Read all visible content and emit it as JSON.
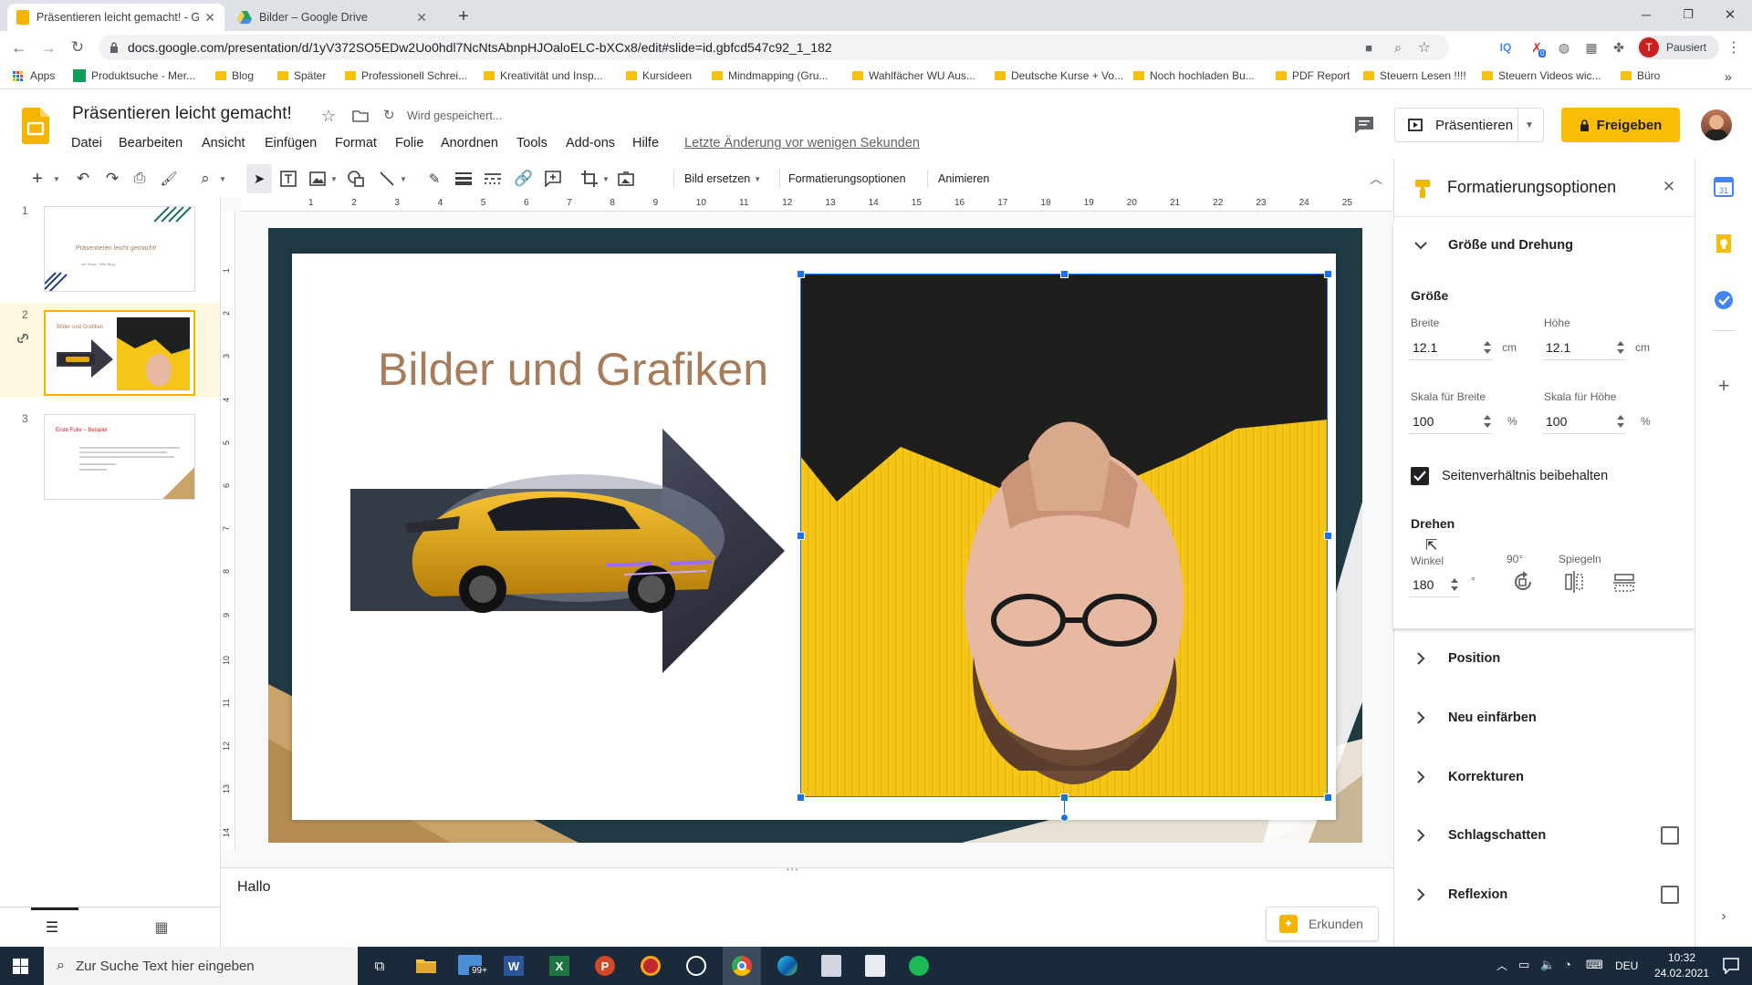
{
  "tabs": [
    {
      "title": "Präsentieren leicht gemacht! - G",
      "active": true
    },
    {
      "title": "Bilder – Google Drive",
      "active": false
    }
  ],
  "browser": {
    "url": "docs.google.com/presentation/d/1yV372SO5EDw2Uo0hdl7NcNtsAbnpHJOaloELC-bXCx8/edit#slide=id.gbfcd547c92_1_182",
    "profile_label": "Pausiert",
    "profile_initial": "T",
    "extension_badge": "0"
  },
  "bookmarks": [
    {
      "label": "Apps"
    },
    {
      "label": "Produktsuche - Mer..."
    },
    {
      "label": "Blog"
    },
    {
      "label": "Später"
    },
    {
      "label": "Professionell Schrei..."
    },
    {
      "label": "Kreativität und Insp..."
    },
    {
      "label": "Kursideen"
    },
    {
      "label": "Mindmapping (Gru..."
    },
    {
      "label": "Wahlfächer WU Aus..."
    },
    {
      "label": "Deutsche Kurse + Vo..."
    },
    {
      "label": "Noch hochladen Bu..."
    },
    {
      "label": "PDF Report"
    },
    {
      "label": "Steuern Lesen !!!!"
    },
    {
      "label": "Steuern Videos wic..."
    },
    {
      "label": "Büro"
    }
  ],
  "doc": {
    "title": "Präsentieren leicht gemacht!",
    "save_status": "Wird gespeichert...",
    "last_edit": "Letzte Änderung vor wenigen Sekunden",
    "present_label": "Präsentieren",
    "share_label": "Freigeben"
  },
  "menus": [
    "Datei",
    "Bearbeiten",
    "Ansicht",
    "Einfügen",
    "Format",
    "Folie",
    "Anordnen",
    "Tools",
    "Add-ons",
    "Hilfe"
  ],
  "toolbar": {
    "replace_image": "Bild ersetzen",
    "format_options": "Formatierungsoptionen",
    "animate": "Animieren"
  },
  "ruler": {
    "top": [
      "1",
      "2",
      "3",
      "4",
      "5",
      "6",
      "7",
      "8",
      "9",
      "10",
      "11",
      "12",
      "13",
      "14",
      "15",
      "16",
      "17",
      "18",
      "19",
      "20",
      "21",
      "22",
      "23",
      "24",
      "25"
    ],
    "left": [
      "1",
      "2",
      "3",
      "4",
      "5",
      "6",
      "7",
      "8",
      "9",
      "10",
      "11",
      "12",
      "13",
      "14"
    ]
  },
  "slides": [
    {
      "number": "1",
      "title": "Präsentieren leicht gemacht!",
      "subtitle": "mit Tanja - Hilfe Blog"
    },
    {
      "number": "2",
      "title": "Bilder und Grafiken"
    },
    {
      "number": "3",
      "title": "Erste Folie – Beispiel"
    }
  ],
  "slide": {
    "title": "Bilder und Grafiken"
  },
  "notes": {
    "text": "Hallo",
    "explore_label": "Erkunden"
  },
  "panel": {
    "title": "Formatierungsoptionen",
    "size_section": "Größe und Drehung",
    "size_heading": "Größe",
    "width_label": "Breite",
    "width_value": "12.1",
    "height_label": "Höhe",
    "height_value": "12.1",
    "unit_cm": "cm",
    "scale_w_label": "Skala für Breite",
    "scale_w_value": "100",
    "scale_h_label": "Skala für Höhe",
    "scale_h_value": "100",
    "unit_pct": "%",
    "aspect_label": "Seitenverhältnis beibehalten",
    "aspect_checked": true,
    "rotate_heading": "Drehen",
    "angle_label": "Winkel",
    "angle_value": "180",
    "degree": "°",
    "rotate90_label": "90°",
    "mirror_label": "Spiegeln",
    "sections": [
      "Position",
      "Neu einfärben",
      "Korrekturen",
      "Schlagschatten",
      "Reflexion"
    ]
  },
  "taskbar": {
    "search_placeholder": "Zur Suche Text hier eingeben",
    "mail_badge": "99+",
    "lang": "DEU",
    "time": "10:32",
    "date": "24.02.2021"
  },
  "colors": {
    "accent": "#1a73e8",
    "share_yellow": "#fbbc04",
    "slides_yellow": "#f4b400",
    "slide_title": "#a67c5b",
    "photo_yellow": "#f5c518"
  }
}
